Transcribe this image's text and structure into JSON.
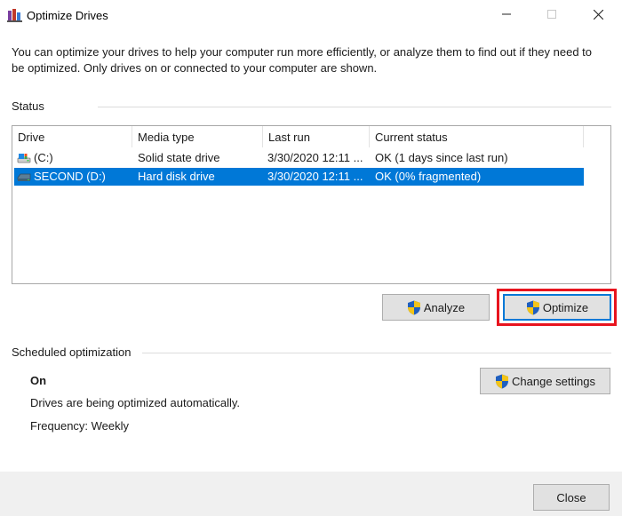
{
  "window": {
    "title": "Optimize Drives",
    "minimize_glyph": "—",
    "maximize_glyph": "☐",
    "close_glyph": "✕"
  },
  "description": "You can optimize your drives to help your computer run more efficiently, or analyze them to find out if they need to be optimized. Only drives on or connected to your computer are shown.",
  "status": {
    "label": "Status",
    "columns": [
      "Drive",
      "Media type",
      "Last run",
      "Current status"
    ],
    "drives": [
      {
        "drive": "(C:)",
        "media_type": "Solid state drive",
        "last_run": "3/30/2020 12:11 ...",
        "current_status": "OK (1 days since last run)",
        "icon": "ssd-drive-icon",
        "selected": false
      },
      {
        "drive": "SECOND (D:)",
        "media_type": "Hard disk drive",
        "last_run": "3/30/2020 12:11 ...",
        "current_status": "OK (0% fragmented)",
        "icon": "hdd-drive-icon",
        "selected": true
      }
    ]
  },
  "actions": {
    "analyze_label": "Analyze",
    "optimize_label": "Optimize"
  },
  "scheduled": {
    "label": "Scheduled optimization",
    "state": "On",
    "description": "Drives are being optimized automatically.",
    "frequency": "Frequency: Weekly",
    "change_settings_label": "Change settings"
  },
  "footer": {
    "close_label": "Close"
  },
  "colors": {
    "selection": "#0078d7",
    "highlight_outline": "#e8141e",
    "button_face": "#e1e1e1",
    "footer_bg": "#f0f0f0"
  }
}
